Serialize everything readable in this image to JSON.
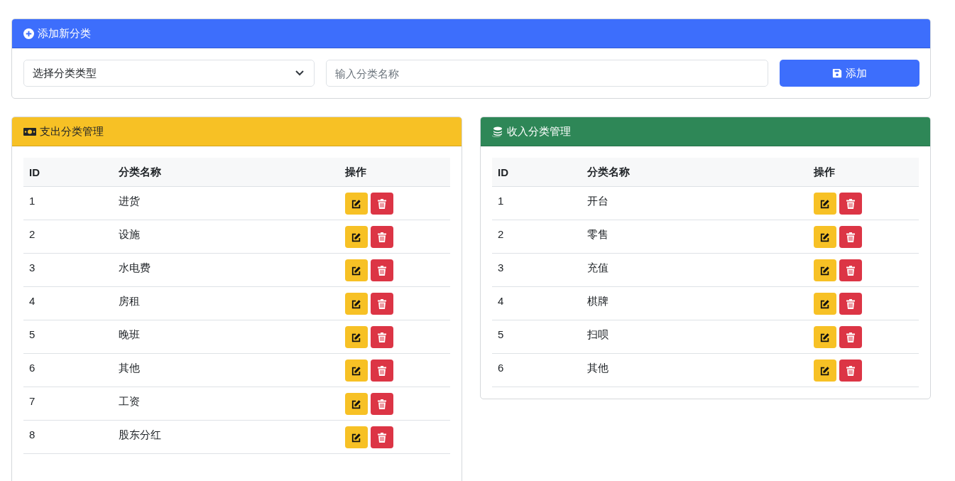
{
  "add_form": {
    "title": "添加新分类",
    "type_select": {
      "placeholder": "选择分类类型"
    },
    "name_input": {
      "placeholder": "输入分类名称"
    },
    "add_button": "添加"
  },
  "panels": [
    {
      "kind": "expense",
      "title": "支出分类管理",
      "columns": [
        "ID",
        "分类名称",
        "操作"
      ],
      "rows": [
        {
          "id": "1",
          "name": "进货"
        },
        {
          "id": "2",
          "name": "设施"
        },
        {
          "id": "3",
          "name": "水电费"
        },
        {
          "id": "4",
          "name": "房租"
        },
        {
          "id": "5",
          "name": "晚班"
        },
        {
          "id": "6",
          "name": "其他"
        },
        {
          "id": "7",
          "name": "工资"
        },
        {
          "id": "8",
          "name": "股东分红"
        }
      ]
    },
    {
      "kind": "income",
      "title": "收入分类管理",
      "columns": [
        "ID",
        "分类名称",
        "操作"
      ],
      "rows": [
        {
          "id": "1",
          "name": "开台"
        },
        {
          "id": "2",
          "name": "零售"
        },
        {
          "id": "3",
          "name": "充值"
        },
        {
          "id": "4",
          "name": "棋牌"
        },
        {
          "id": "5",
          "name": "扫呗"
        },
        {
          "id": "6",
          "name": "其他"
        }
      ]
    }
  ]
}
